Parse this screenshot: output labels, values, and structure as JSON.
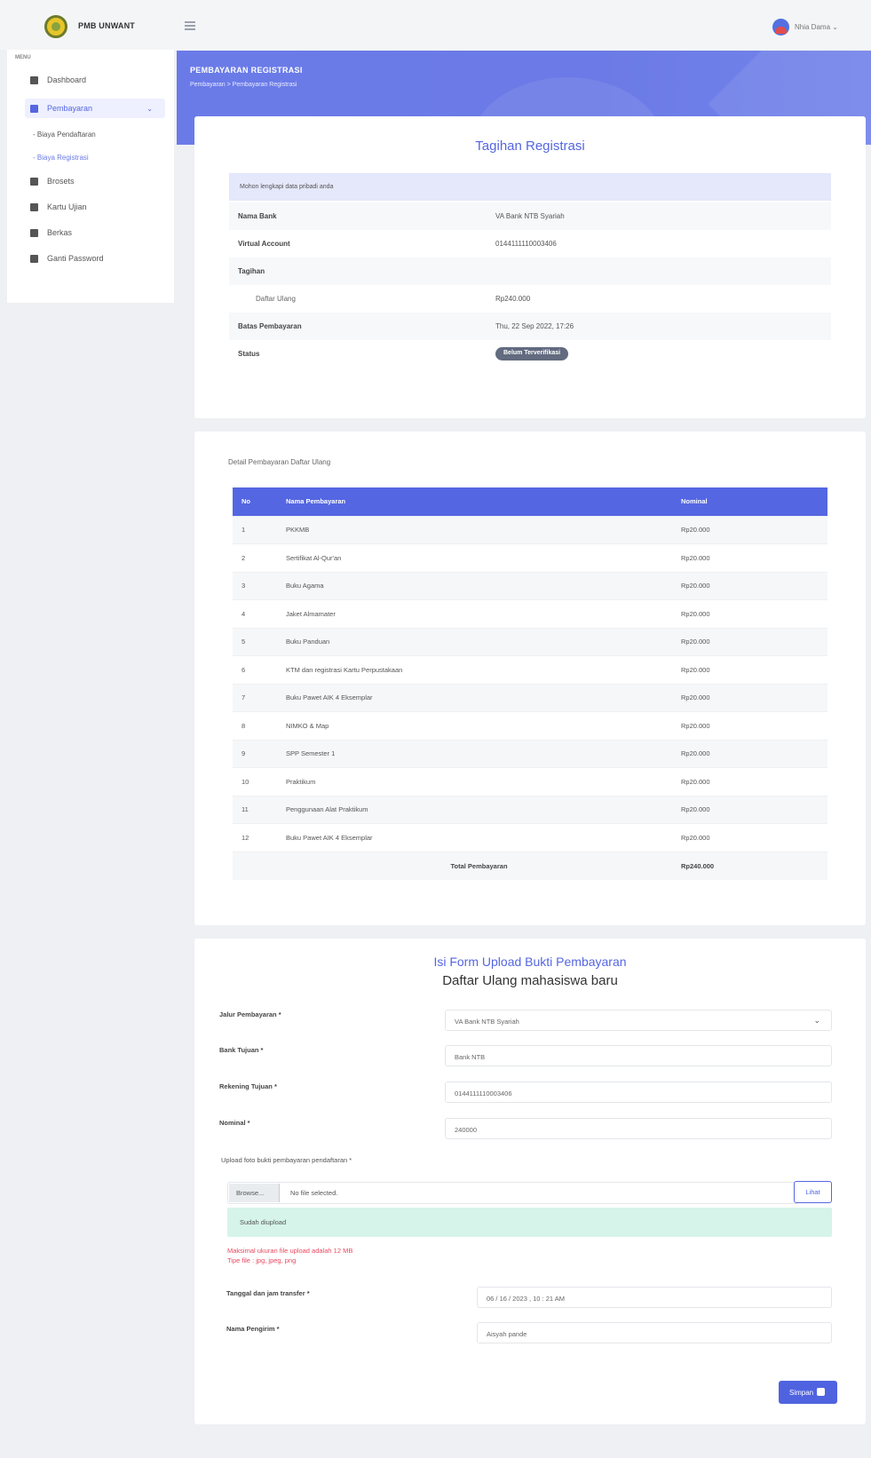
{
  "header": {
    "brand": "PMB UNWANT",
    "user_name": "Nhia Dama"
  },
  "sidebar": {
    "menu_label": "MENU",
    "items": [
      {
        "label": "Dashboard",
        "icon": "home-icon"
      },
      {
        "label": "Pembayaran",
        "icon": "credit-card-icon",
        "active": true
      },
      {
        "label": "Brosets",
        "icon": "book-icon"
      },
      {
        "label": "Kartu Ujian",
        "icon": "id-card-icon"
      },
      {
        "label": "Berkas",
        "icon": "paperclip-icon"
      },
      {
        "label": "Ganti Password",
        "icon": "lock-icon"
      }
    ],
    "sub_items": [
      {
        "label": "- Biaya Pendaftaran"
      },
      {
        "label": "- Biaya Registrasi",
        "current": true
      }
    ]
  },
  "banner": {
    "title": "PEMBAYARAN REGISTRASI",
    "breadcrumb": "Pembayaran  >  Pembayaran Registrasi"
  },
  "tagihan": {
    "title": "Tagihan Registrasi",
    "notice": "Mohon lengkapi data pribadi anda",
    "rows": [
      {
        "label": "Nama Bank",
        "value": "VA Bank NTB Syariah"
      },
      {
        "label": "Virtual Account",
        "value": "0144111110003406"
      },
      {
        "label": "Tagihan",
        "value": ""
      },
      {
        "label": "Daftar Ulang",
        "value": "Rp240.000"
      },
      {
        "label": "Batas Pembayaran",
        "value": "Thu, 22 Sep 2022, 17:26"
      },
      {
        "label": "Status"
      }
    ],
    "status": "Belum Terverifikasi"
  },
  "rincian": {
    "caption": "Detail Pembayaran Daftar Ulang",
    "headers": [
      "No",
      "Nama Pembayaran",
      "Nominal"
    ],
    "rows": [
      [
        "1",
        "PKKMB",
        "Rp20.000"
      ],
      [
        "2",
        "Sertifikat Al-Qur'an",
        "Rp20.000"
      ],
      [
        "3",
        "Buku Agama",
        "Rp20.000"
      ],
      [
        "4",
        "Jaket Almamater",
        "Rp20.000"
      ],
      [
        "5",
        "Buku Panduan",
        "Rp20.000"
      ],
      [
        "6",
        "KTM dan registrasi Kartu Perpustakaan",
        "Rp20.000"
      ],
      [
        "7",
        "Buku Pawet AIK 4 Eksemplar",
        "Rp20.000"
      ],
      [
        "8",
        "NIMKO & Map",
        "Rp20.000"
      ],
      [
        "9",
        "SPP Semester 1",
        "Rp20.000"
      ],
      [
        "10",
        "Praktikum",
        "Rp20.000"
      ],
      [
        "11",
        "Penggunaan Alat Praktikum",
        "Rp20.000"
      ],
      [
        "12",
        "Buku Pawet AIK 4 Eksemplar",
        "Rp20.000"
      ]
    ],
    "total_label": "Total Pembayaran",
    "total_value": "Rp240.000"
  },
  "form": {
    "title": "Isi Form Upload Bukti Pembayaran",
    "subtitle": "Daftar Ulang mahasiswa baru",
    "jalur_label": "Jalur Pembayaran *",
    "jalur_value": "VA Bank NTB Syariah",
    "bank_label": "Bank Tujuan *",
    "bank_value": "Bank NTB",
    "rekening_label": "Rekening Tujuan *",
    "rekening_value": "0144111110003406",
    "nominal_label": "Nominal *",
    "nominal_value": "240000",
    "upload_label": "Upload foto bukti pembayaran pendaftaran *",
    "browse_label": "Browse...",
    "file_text": "No file selected.",
    "view_label": "Lihat",
    "upload_status": "Sudah diupload",
    "note_max": "Maksimal ukuran file upload adalah 12 MB",
    "note_types": "Tipe file : jpg, jpeg, png",
    "tanggal_label": "Tanggal dan jam transfer *",
    "tanggal_value": "06 / 16 / 2023 ,  10 : 21  AM",
    "pengirim_label": "Nama Pengirim *",
    "pengirim_value": "Aisyah pande",
    "save_label": "Simpan"
  },
  "colors": {
    "accent": "#5566e0",
    "banner": "#6a7be8",
    "badge": "#626b7f",
    "success_bg": "#d6f4e9",
    "error_text": "#e8495f"
  }
}
